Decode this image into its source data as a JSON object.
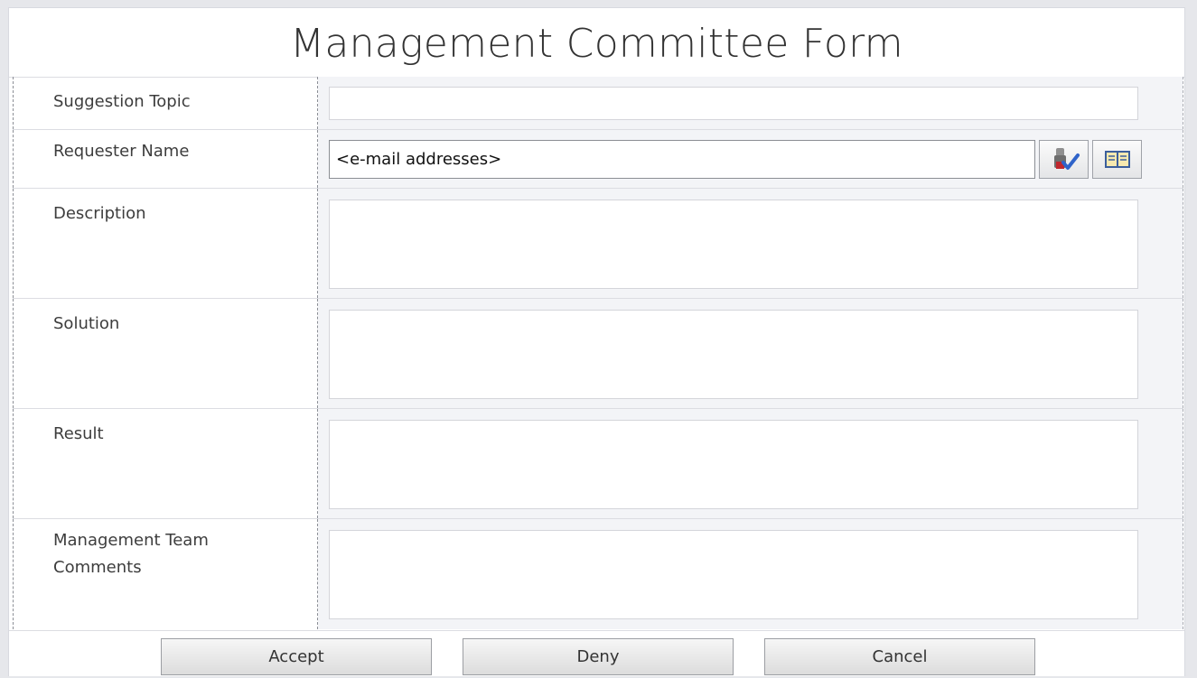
{
  "form": {
    "title": "Management Committee Form",
    "fields": {
      "suggestion_topic": {
        "label": "Suggestion Topic",
        "value": ""
      },
      "requester_name": {
        "label": "Requester Name",
        "value": "<e-mail addresses>",
        "check_names_icon": "check-names-icon",
        "address_book_icon": "address-book-icon"
      },
      "description": {
        "label": "Description",
        "value": ""
      },
      "solution": {
        "label": "Solution",
        "value": ""
      },
      "result": {
        "label": "Result",
        "value": ""
      },
      "management_team_comments": {
        "label": "Management Team\nComments",
        "value": ""
      }
    },
    "buttons": {
      "accept": "Accept",
      "deny": "Deny",
      "cancel": "Cancel"
    }
  }
}
